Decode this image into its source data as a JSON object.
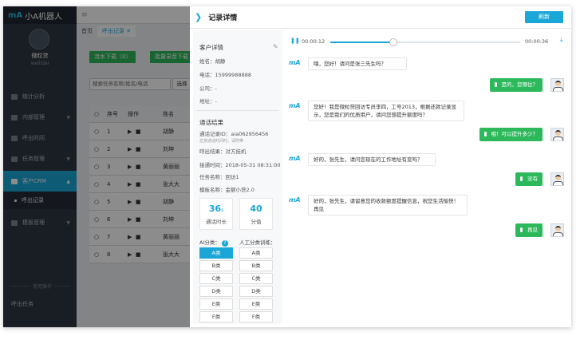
{
  "app": {
    "logo": "mA",
    "title": "小A机器人"
  },
  "user": {
    "name": "微粒贷",
    "sub": "weilidai"
  },
  "sidebar": {
    "items": [
      {
        "label": "统计分析"
      },
      {
        "label": "内部管理"
      },
      {
        "label": "呼出时间"
      },
      {
        "label": "任务管理"
      },
      {
        "label": "客户CRM"
      },
      {
        "label": "模板管理"
      }
    ],
    "sub_item": "呼出记录",
    "section": "常用操作",
    "bottom": "呼出任务"
  },
  "main": {
    "tabs": [
      "首页",
      "呼出记录 ✕"
    ],
    "buttons": [
      "流水下载（0）",
      "批量录音下载"
    ],
    "search_placeholder": "搜索任务名称/姓名/电话",
    "search_btn": "选择",
    "headers": [
      "序号",
      "操作",
      "姓名"
    ],
    "rows": [
      {
        "n": "1",
        "name": "胡静"
      },
      {
        "n": "2",
        "name": "刘坤"
      },
      {
        "n": "3",
        "name": "黄丽丽"
      },
      {
        "n": "4",
        "name": "张大大"
      },
      {
        "n": "5",
        "name": "胡静"
      },
      {
        "n": "6",
        "name": "刘坤"
      },
      {
        "n": "7",
        "name": "黄丽丽"
      },
      {
        "n": "8",
        "name": "张大大"
      }
    ]
  },
  "panel": {
    "title": "记录详情",
    "refresh": "刷新",
    "customer": {
      "title": "客户详情",
      "name": "姓名：胡静",
      "phone": "电话：15999988888",
      "company": "公司：-",
      "address": "地址：-"
    },
    "result": {
      "title": "通话结果",
      "call_id": "通话记录ID：aia062956456",
      "hint": "拉货通话时间时，请附带",
      "outcome": "呼出结果：对方挂机",
      "time": "接通时间：2018-05-31 08:31:00",
      "task": "任务名称：回访1",
      "template": "模板名称：金额小贷2.0"
    },
    "stats": {
      "duration_value": "36",
      "duration_unit": "s",
      "duration_label": "通话时长",
      "score_value": "40",
      "score_label": "分值"
    },
    "ai_label": "AI分类：",
    "ai_help": "?",
    "manual_label": "人工分类训练：",
    "classes": [
      "A类",
      "B类",
      "C类",
      "D类",
      "E类",
      "F类"
    ],
    "ai_selected": "A类"
  },
  "audio": {
    "current": "00:00:12",
    "total": "00:00:36",
    "progress": 0.333
  },
  "chat": [
    {
      "who": "bot",
      "text": "喂，您好！请问是张三先生吗？"
    },
    {
      "who": "user",
      "text": "是的，您哪位？"
    },
    {
      "who": "bot",
      "text": "您好！我是微粒贷回访专员李四，工号2013，根据还款记录显示，您是我们的优质用户，请问您想提升额度吗？"
    },
    {
      "who": "user",
      "text": "哦！可以提升多少？"
    },
    {
      "who": "bot",
      "text": "好的，张先生，请问您现在的工作地址有变吗？"
    },
    {
      "who": "user",
      "text": "没有"
    },
    {
      "who": "bot",
      "text": "好的，张先生，请留意您的收款额度提醒信息，祝您生活愉快！再见"
    },
    {
      "who": "user",
      "text": "再见"
    }
  ]
}
